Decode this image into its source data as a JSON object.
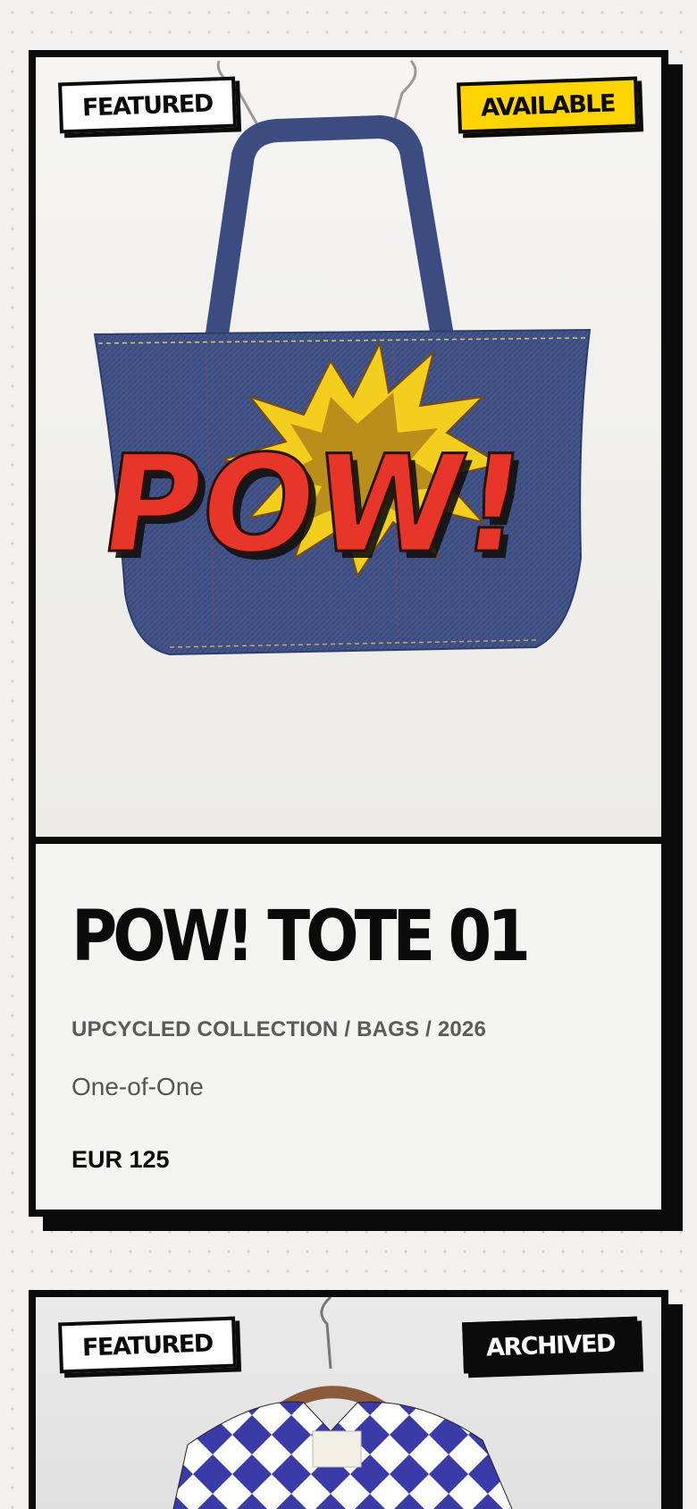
{
  "products": [
    {
      "featured_label": "FEATURED",
      "status_label": "AVAILABLE",
      "image_alt": "POW!",
      "title": "POW! TOTE 01",
      "category": "UPCYCLED COLLECTION / BAGS / 2026",
      "edition": "One-of-One",
      "price": "EUR 125",
      "status_color": "#ffd400"
    },
    {
      "featured_label": "FEATURED",
      "status_label": "ARCHIVED",
      "status_color": "#0b0b0b"
    }
  ],
  "colors": {
    "background": "#f2f1ef",
    "ink": "#0b0b0b",
    "accent_yellow": "#ffd400",
    "denim": "#3e4f82",
    "pow_red": "#e8352a"
  }
}
